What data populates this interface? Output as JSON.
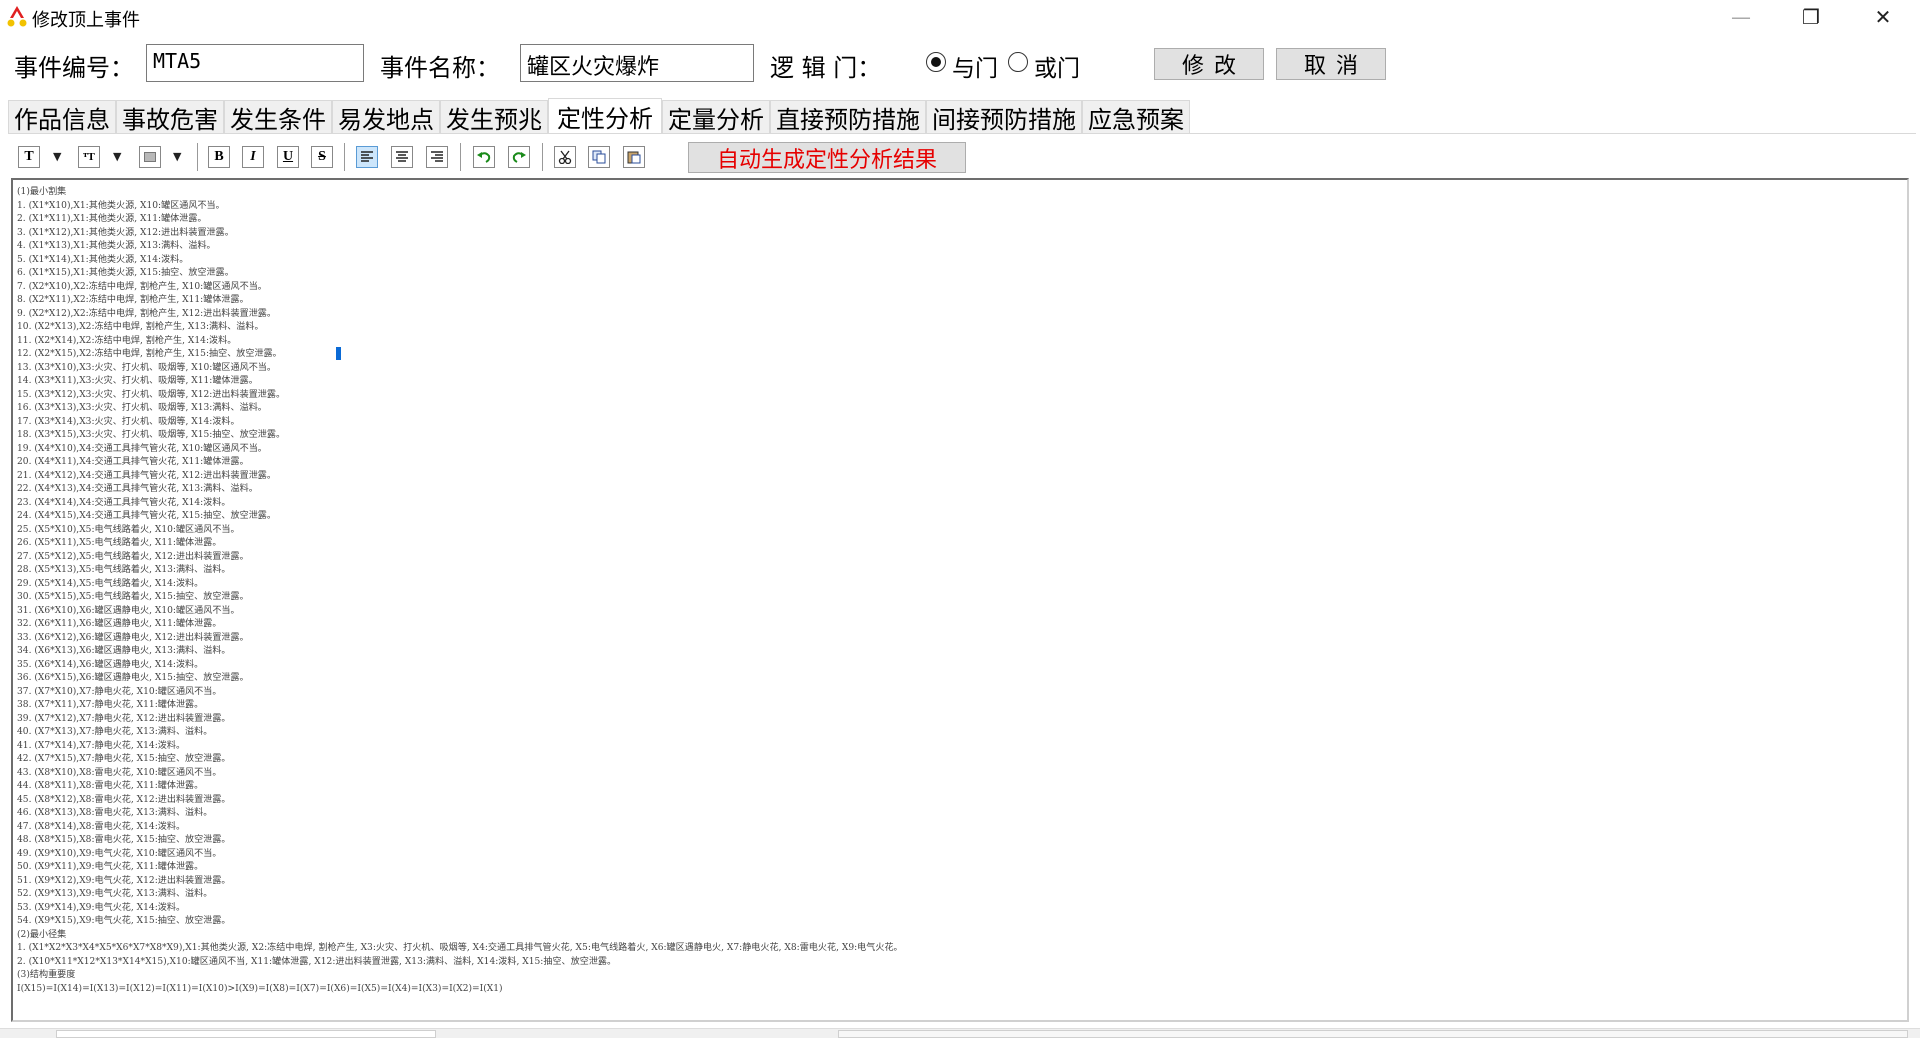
{
  "window": {
    "title": "修改顶上事件",
    "min_glyph": "—",
    "max_glyph": "❐",
    "close_glyph": "✕"
  },
  "header": {
    "event_no_label": "事件编号：",
    "event_no_value": "MTA5",
    "event_name_label": "事件名称：",
    "event_name_value": "罐区火灾爆炸",
    "logic_label": "逻 辑 门：",
    "and_label": "与门",
    "or_label": "或门",
    "and_selected": true,
    "modify_label": "修改",
    "cancel_label": "取消"
  },
  "tabs": [
    {
      "label": "作品信息",
      "active": false
    },
    {
      "label": "事故危害",
      "active": false
    },
    {
      "label": "发生条件",
      "active": false
    },
    {
      "label": "易发地点",
      "active": false
    },
    {
      "label": "发生预兆",
      "active": false
    },
    {
      "label": "定性分析",
      "active": true
    },
    {
      "label": "定量分析",
      "active": false
    },
    {
      "label": "直接预防措施",
      "active": false
    },
    {
      "label": "间接预防措施",
      "active": false
    },
    {
      "label": "应急预案",
      "active": false
    }
  ],
  "toolbar": {
    "font_glyph": "T",
    "fontsize_glyph": "ᵀT",
    "bold_glyph": "B",
    "italic_glyph": "I",
    "underline_glyph": "U",
    "strike_glyph": "S",
    "generate_label": "自动生成定性分析结果",
    "generate_color": "#e60000"
  },
  "content": {
    "lines": [
      "(1)最小割集",
      "1. (X1*X10),X1:其他类火源, X10:罐区通风不当。",
      "2. (X1*X11),X1:其他类火源, X11:罐体泄露。",
      "3. (X1*X12),X1:其他类火源, X12:进出料装置泄露。",
      "4. (X1*X13),X1:其他类火源, X13:满料、溢料。",
      "5. (X1*X14),X1:其他类火源, X14:泼料。",
      "6. (X1*X15),X1:其他类火源, X15:抽空、放空泄露。",
      "7. (X2*X10),X2:冻结中电焊, 割枪产生, X10:罐区通风不当。",
      "8. (X2*X11),X2:冻结中电焊, 割枪产生, X11:罐体泄露。",
      "9. (X2*X12),X2:冻结中电焊, 割枪产生, X12:进出料装置泄露。",
      "10. (X2*X13),X2:冻结中电焊, 割枪产生, X13:满料、溢料。",
      "11. (X2*X14),X2:冻结中电焊, 割枪产生, X14:泼料。",
      "12. (X2*X15),X2:冻结中电焊, 割枪产生, X15:抽空、放空泄露。",
      "13. (X3*X10),X3:火灾、打火机、吸烟等, X10:罐区通风不当。",
      "14. (X3*X11),X3:火灾、打火机、吸烟等, X11:罐体泄露。",
      "15. (X3*X12),X3:火灾、打火机、吸烟等, X12:进出料装置泄露。",
      "16. (X3*X13),X3:火灾、打火机、吸烟等, X13:满料、溢料。",
      "17. (X3*X14),X3:火灾、打火机、吸烟等, X14:泼料。",
      "18. (X3*X15),X3:火灾、打火机、吸烟等, X15:抽空、放空泄露。",
      "19. (X4*X10),X4:交通工具排气管火花, X10:罐区通风不当。",
      "20. (X4*X11),X4:交通工具排气管火花, X11:罐体泄露。",
      "21. (X4*X12),X4:交通工具排气管火花, X12:进出料装置泄露。",
      "22. (X4*X13),X4:交通工具排气管火花, X13:满料、溢料。",
      "23. (X4*X14),X4:交通工具排气管火花, X14:泼料。",
      "24. (X4*X15),X4:交通工具排气管火花, X15:抽空、放空泄露。",
      "25. (X5*X10),X5:电气线路着火, X10:罐区通风不当。",
      "26. (X5*X11),X5:电气线路着火, X11:罐体泄露。",
      "27. (X5*X12),X5:电气线路着火, X12:进出料装置泄露。",
      "28. (X5*X13),X5:电气线路着火, X13:满料、溢料。",
      "29. (X5*X14),X5:电气线路着火, X14:泼料。",
      "30. (X5*X15),X5:电气线路着火, X15:抽空、放空泄露。",
      "31. (X6*X10),X6:罐区遇静电火, X10:罐区通风不当。",
      "32. (X6*X11),X6:罐区遇静电火, X11:罐体泄露。",
      "33. (X6*X12),X6:罐区遇静电火, X12:进出料装置泄露。",
      "34. (X6*X13),X6:罐区遇静电火, X13:满料、溢料。",
      "35. (X6*X14),X6:罐区遇静电火, X14:泼料。",
      "36. (X6*X15),X6:罐区遇静电火, X15:抽空、放空泄露。",
      "37. (X7*X10),X7:静电火花, X10:罐区通风不当。",
      "38. (X7*X11),X7:静电火花, X11:罐体泄露。",
      "39. (X7*X12),X7:静电火花, X12:进出料装置泄露。",
      "40. (X7*X13),X7:静电火花, X13:满料、溢料。",
      "41. (X7*X14),X7:静电火花, X14:泼料。",
      "42. (X7*X15),X7:静电火花, X15:抽空、放空泄露。",
      "43. (X8*X10),X8:雷电火花, X10:罐区通风不当。",
      "44. (X8*X11),X8:雷电火花, X11:罐体泄露。",
      "45. (X8*X12),X8:雷电火花, X12:进出料装置泄露。",
      "46. (X8*X13),X8:雷电火花, X13:满料、溢料。",
      "47. (X8*X14),X8:雷电火花, X14:泼料。",
      "48. (X8*X15),X8:雷电火花, X15:抽空、放空泄露。",
      "49. (X9*X10),X9:电气火花, X10:罐区通风不当。",
      "50. (X9*X11),X9:电气火花, X11:罐体泄露。",
      "51. (X9*X12),X9:电气火花, X12:进出料装置泄露。",
      "52. (X9*X13),X9:电气火花, X13:满料、溢料。",
      "53. (X9*X14),X9:电气火花, X14:泼料。",
      "54. (X9*X15),X9:电气火花, X15:抽空、放空泄露。",
      "(2)最小径集",
      "1. (X1*X2*X3*X4*X5*X6*X7*X8*X9),X1:其他类火源, X2:冻结中电焊, 割枪产生, X3:火灾、打火机、吸烟等, X4:交通工具排气管火花, X5:电气线路着火, X6:罐区遇静电火, X7:静电火花, X8:雷电火花, X9:电气火花。",
      "2. (X10*X11*X12*X13*X14*X15),X10:罐区通风不当, X11:罐体泄露, X12:进出料装置泄露, X13:满料、溢料, X14:泼料, X15:抽空、放空泄露。",
      "(3)结构重要度",
      "I(X15)=I(X14)=I(X13)=I(X12)=I(X11)=I(X10)>I(X9)=I(X8)=I(X7)=I(X6)=I(X5)=I(X4)=I(X3)=I(X2)=I(X1)"
    ]
  }
}
